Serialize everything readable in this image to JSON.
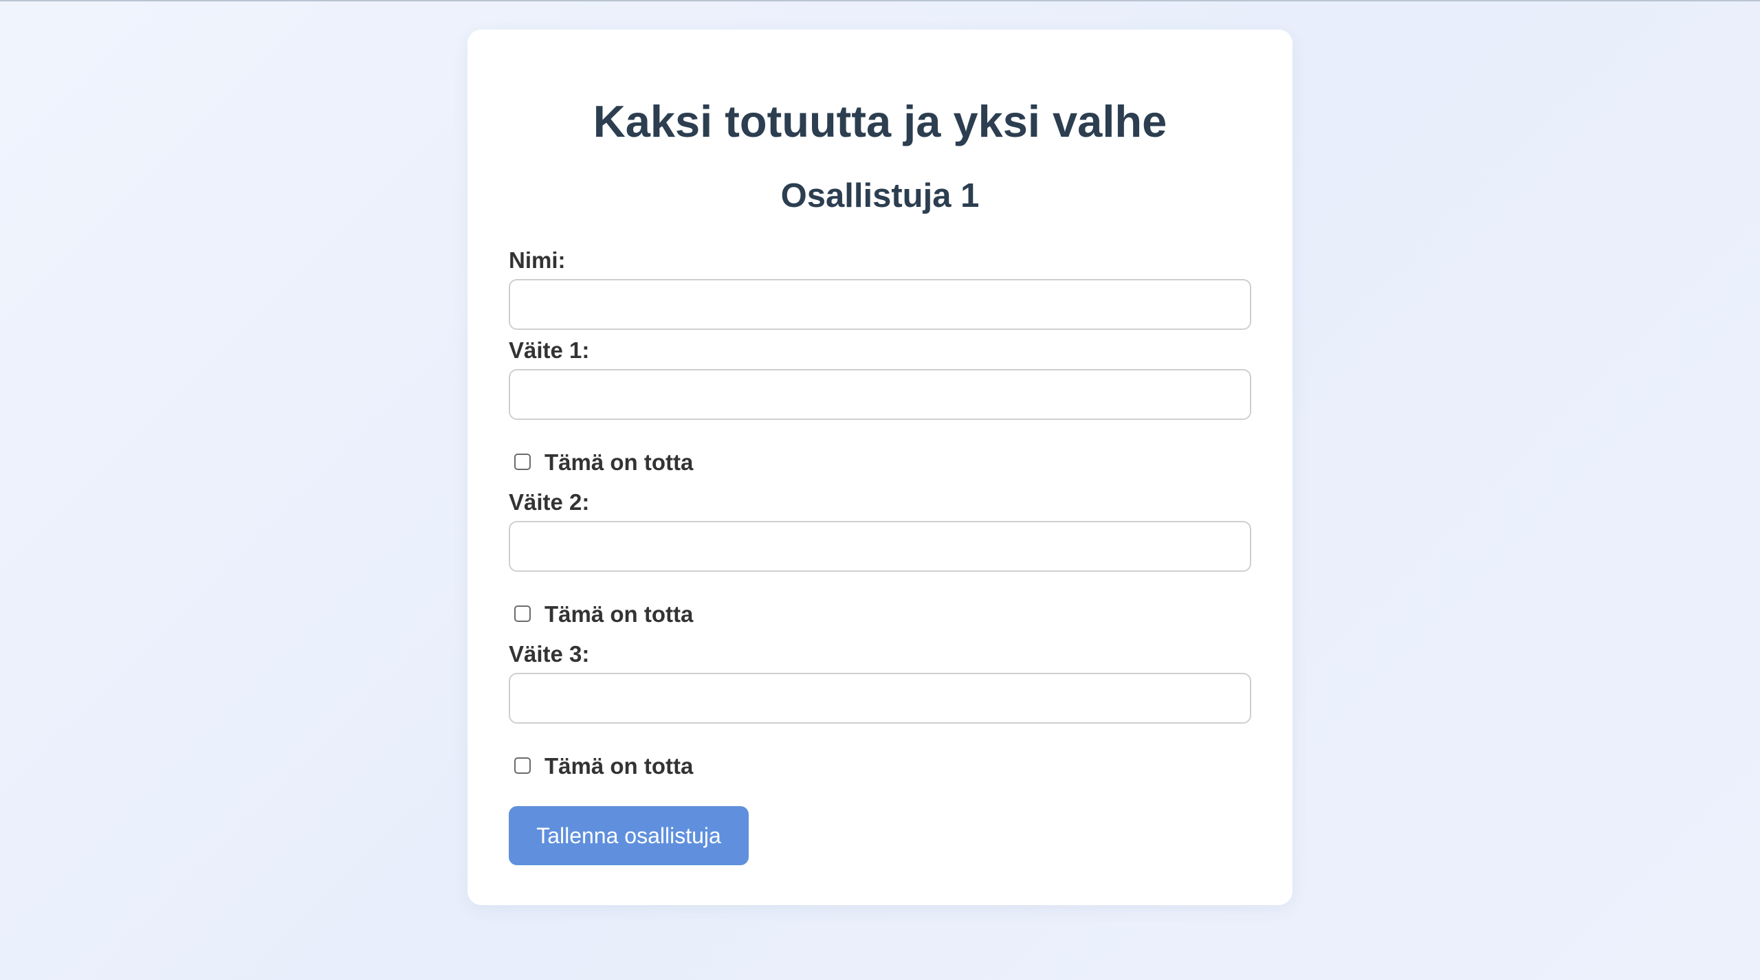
{
  "form": {
    "title": "Kaksi totuutta ja yksi valhe",
    "participant_heading": "Osallistuja 1",
    "name_label": "Nimi:",
    "name_value": "",
    "claims": [
      {
        "label": "Väite 1:",
        "value": "",
        "checkbox_label": "Tämä on totta",
        "checked": false
      },
      {
        "label": "Väite 2:",
        "value": "",
        "checkbox_label": "Tämä on totta",
        "checked": false
      },
      {
        "label": "Väite 3:",
        "value": "",
        "checkbox_label": "Tämä on totta",
        "checked": false
      }
    ],
    "save_label": "Tallenna osallistuja"
  },
  "colors": {
    "heading": "#2c3e50",
    "button": "#6090dd",
    "background": "#ecf0fc"
  }
}
